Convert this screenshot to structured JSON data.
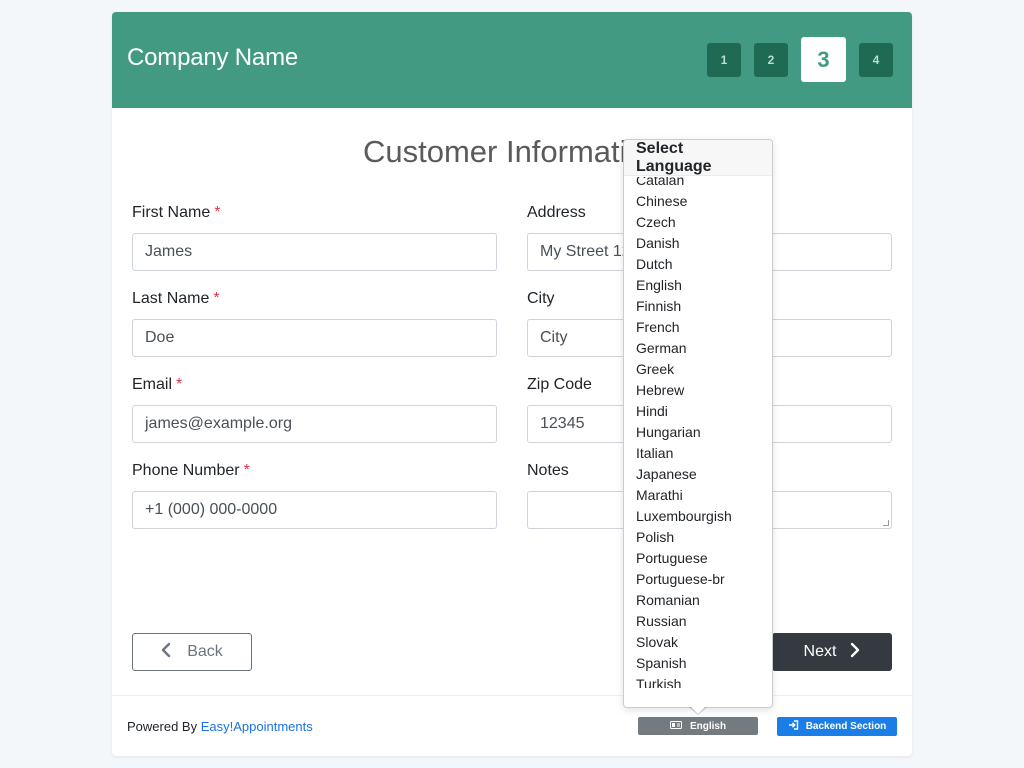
{
  "header": {
    "company_name": "Company Name",
    "steps": [
      "1",
      "2",
      "3",
      "4"
    ],
    "active_step": "3"
  },
  "main": {
    "title": "Customer Information",
    "required_marker": "*",
    "fields": {
      "first_name": {
        "label": "First Name",
        "value": "James"
      },
      "last_name": {
        "label": "Last Name",
        "value": "Doe"
      },
      "email": {
        "label": "Email",
        "value": "james@example.org"
      },
      "phone": {
        "label": "Phone Number",
        "value": "+1 (000) 000-0000"
      },
      "address": {
        "label": "Address",
        "value": "My Street 12"
      },
      "city": {
        "label": "City",
        "value": "City"
      },
      "zip": {
        "label": "Zip Code",
        "value": "12345"
      },
      "notes": {
        "label": "Notes",
        "value": ""
      }
    },
    "back_label": "Back",
    "next_label": "Next"
  },
  "footer": {
    "powered_by": "Powered By",
    "brand_link": "Easy!Appointments",
    "language_button": "English",
    "backend_button": "Backend Section"
  },
  "language_popover": {
    "title": "Select Language",
    "languages": [
      "Catalan",
      "Chinese",
      "Czech",
      "Danish",
      "Dutch",
      "English",
      "Finnish",
      "French",
      "German",
      "Greek",
      "Hebrew",
      "Hindi",
      "Hungarian",
      "Italian",
      "Japanese",
      "Marathi",
      "Luxembourgish",
      "Polish",
      "Portuguese",
      "Portuguese-br",
      "Romanian",
      "Russian",
      "Slovak",
      "Spanish",
      "Turkish"
    ]
  },
  "colors": {
    "header": "#429a82",
    "step_inactive": "#1f6a52",
    "next_button": "#343a40",
    "backend_button": "#1a7ee6",
    "required": "#dc3545"
  },
  "icons": {
    "back": "chevron-left-icon",
    "next": "chevron-right-icon",
    "language": "language-icon",
    "backend": "sign-in-icon"
  }
}
